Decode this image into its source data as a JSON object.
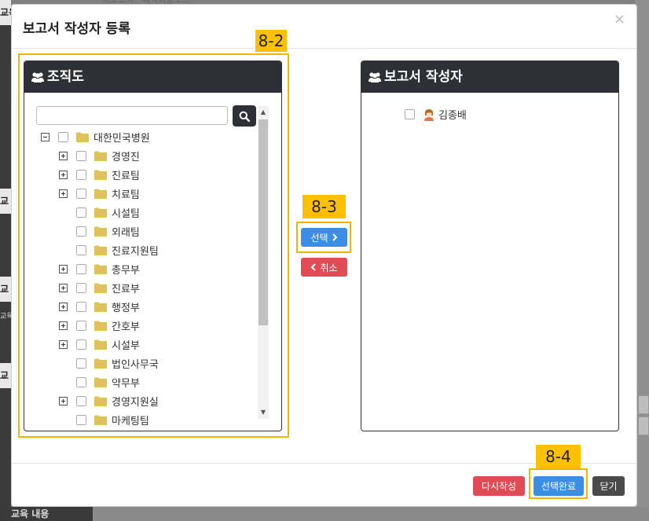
{
  "background": {
    "top_text": "이모조직 · 내역이동모드",
    "left_tabs": [
      "교육 유형",
      "교",
      "교",
      "교"
    ],
    "left_small": "교육",
    "bottom_label": "교육 내용"
  },
  "modal": {
    "title": "보고서 작성자 등록",
    "close_glyph": "×",
    "org_panel": {
      "title": "조직도",
      "search_placeholder": "",
      "tree": [
        {
          "label": "대한민국병원",
          "expander": "minus",
          "level": 0
        },
        {
          "label": "경영진",
          "expander": "plus",
          "level": 1
        },
        {
          "label": "진료팀",
          "expander": "plus",
          "level": 1
        },
        {
          "label": "치료팀",
          "expander": "plus",
          "level": 1
        },
        {
          "label": "시설팀",
          "expander": "none",
          "level": 1
        },
        {
          "label": "외래팀",
          "expander": "none",
          "level": 1
        },
        {
          "label": "진료지원팀",
          "expander": "none",
          "level": 1
        },
        {
          "label": "총무부",
          "expander": "plus",
          "level": 1
        },
        {
          "label": "진료부",
          "expander": "plus",
          "level": 1
        },
        {
          "label": "행정부",
          "expander": "plus",
          "level": 1
        },
        {
          "label": "간호부",
          "expander": "plus",
          "level": 1
        },
        {
          "label": "시설부",
          "expander": "plus",
          "level": 1
        },
        {
          "label": "법인사무국",
          "expander": "none",
          "level": 1
        },
        {
          "label": "약무부",
          "expander": "none",
          "level": 1
        },
        {
          "label": "경영지원실",
          "expander": "plus",
          "level": 1
        },
        {
          "label": "마케팅팀",
          "expander": "none",
          "level": 1
        }
      ]
    },
    "author_panel": {
      "title": "보고서 작성자",
      "authors": [
        {
          "name": "김종배"
        }
      ]
    },
    "buttons": {
      "select": "선택",
      "cancel": "취소",
      "reset": "다시작성",
      "done": "선택완료",
      "close": "닫기"
    }
  },
  "annotations": [
    "8-2",
    "8-3",
    "8-4"
  ],
  "colors": {
    "panel_header": "#2d3035",
    "primary": "#3a8ee6",
    "danger": "#e04b55",
    "dark": "#4a4a4a",
    "annotation": "#ffc000",
    "folder": "#e1c15a"
  }
}
